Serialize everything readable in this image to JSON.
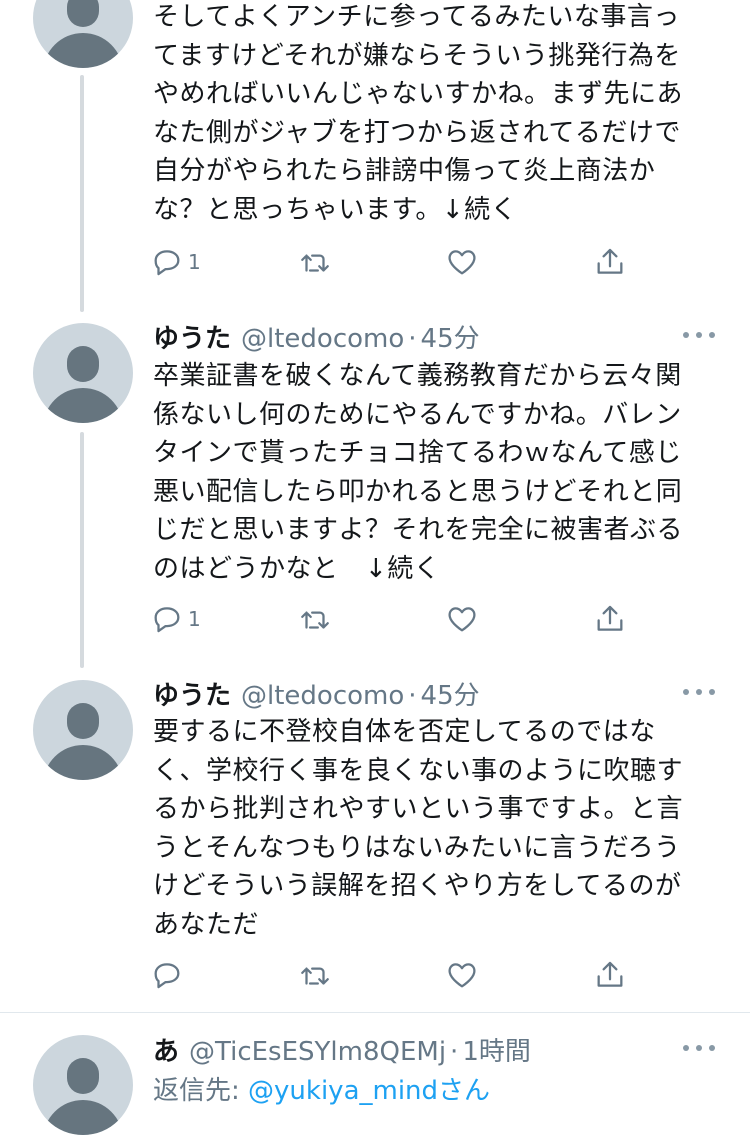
{
  "tweets": [
    {
      "text": "そしてよくアンチに参ってるみたいな事言っ\nてますけどそれが嫌ならそういう挑発行為を\nやめればいいんじゃないすかね。まず先にあ\nなた側がジャブを打つから返されてるだけで\n自分がやられたら誹謗中傷って炎上商法か\nな？と思っちゃいます。↓続く",
      "reply_count": "1"
    },
    {
      "name": "ゆうた",
      "handle": "@ltedocomo",
      "dot": "·",
      "time": "45分",
      "text": "卒業証書を破くなんて義務教育だから云々関\n係ないし何のためにやるんですかね。バレン\nタインで貰ったチョコ捨てるわｗなんて感じ\n悪い配信したら叩かれると思うけどそれと同\nじだと思いますよ？それを完全に被害者ぶる\nのはどうかなと　↓続く",
      "reply_count": "1"
    },
    {
      "name": "ゆうた",
      "handle": "@ltedocomo",
      "dot": "·",
      "time": "45分",
      "text": "要するに不登校自体を否定してるのではな\nく、学校行く事を良くない事のように吹聴す\nるから批判されやすいという事ですよ。と言\nうとそんなつもりはないみたいに言うだろう\nけどそういう誤解を招くやり方をしてるのが\nあなただ",
      "reply_count": ""
    },
    {
      "name": "あ",
      "handle": "@TicEsESYlm8QEMj",
      "dot": "·",
      "time": "1時間",
      "reply_to_label": "返信先: ",
      "reply_to_user": "@yukiya_mindさん"
    }
  ],
  "icons": {
    "reply": "reply-icon",
    "retweet": "retweet-icon",
    "like": "heart-icon",
    "share": "share-icon",
    "more": "more-icon"
  },
  "colors": {
    "text": "#14171a",
    "secondary": "#657786",
    "link": "#1da1f2",
    "thread_line": "#d5dade",
    "avatar_bg": "#ccd6dd",
    "avatar_fg": "#66757f"
  }
}
